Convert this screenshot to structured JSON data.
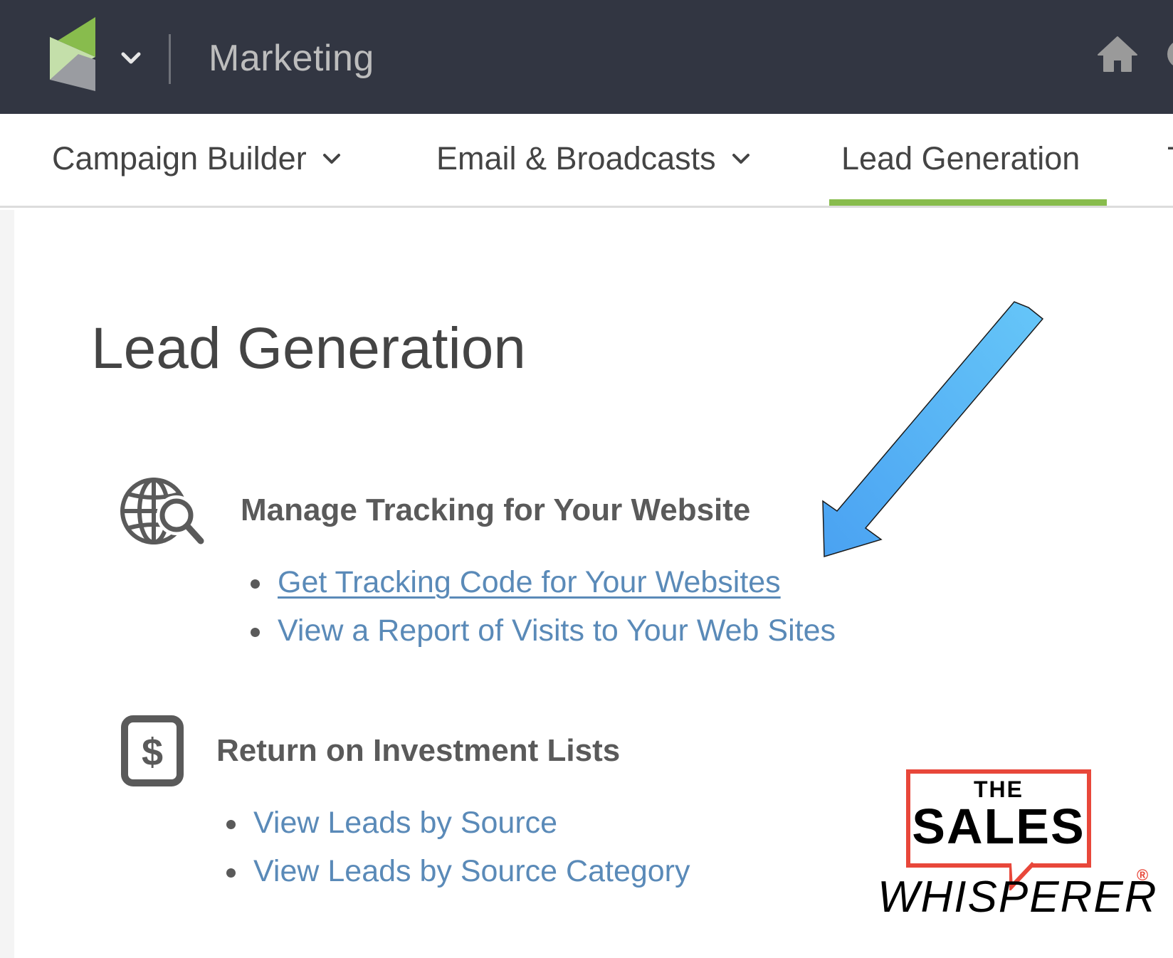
{
  "header": {
    "app_title": "Marketing",
    "logo_icon": "brand-logo-icon",
    "app_switcher_icon": "chevron-down-icon",
    "home_icon": "home-icon"
  },
  "tabs": [
    {
      "label": "Campaign Builder",
      "has_dropdown": true,
      "active": false
    },
    {
      "label": "Email & Broadcasts",
      "has_dropdown": true,
      "active": false
    },
    {
      "label": "Lead Generation",
      "has_dropdown": false,
      "active": true
    },
    {
      "label": "T",
      "has_dropdown": false,
      "active": false
    }
  ],
  "colors": {
    "header_bg": "#323642",
    "active_tab_underline": "#88bc4d",
    "link": "#5a8ab8",
    "heading_text": "#5a5a5a",
    "arrow_fill": "#5ab4f5",
    "watermark_red": "#e8473a"
  },
  "page": {
    "title": "Lead Generation",
    "sections": [
      {
        "icon": "globe-search-icon",
        "heading": "Manage Tracking for Your Website",
        "links": [
          {
            "label": "Get Tracking Code for Your Websites",
            "underlined": true
          },
          {
            "label": "View a Report of Visits to Your Web Sites",
            "underlined": false
          }
        ]
      },
      {
        "icon": "dollar-icon",
        "heading": "Return on Investment Lists",
        "links": [
          {
            "label": "View Leads by Source",
            "underlined": false
          },
          {
            "label": "View Leads by Source Category",
            "underlined": false
          }
        ]
      }
    ]
  },
  "annotation": {
    "type": "arrow",
    "points_to": "Get Tracking Code for Your Websites"
  },
  "watermark": {
    "line1": "THE",
    "line2": "SALES",
    "line3": "WHISPERER",
    "registered": "®"
  }
}
